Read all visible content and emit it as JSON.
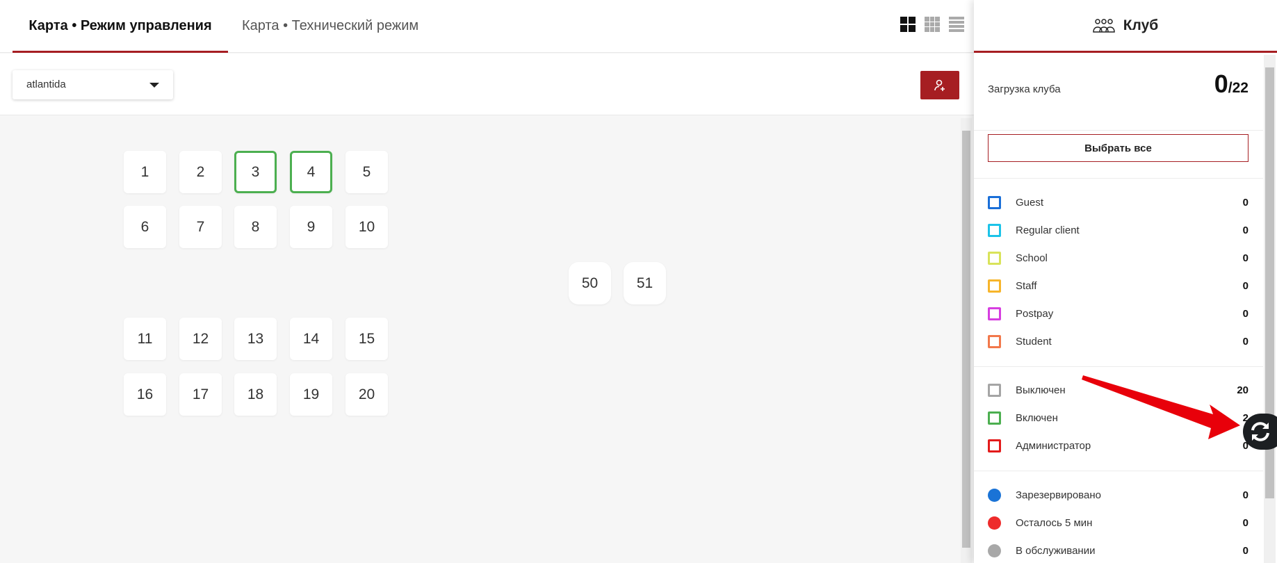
{
  "tabs": [
    {
      "label": "Карта • Режим управления",
      "active": true
    },
    {
      "label": "Карта • Технический режим",
      "active": false
    }
  ],
  "view_icons": [
    "grid-large-icon",
    "grid-small-icon",
    "list-icon"
  ],
  "club_select": {
    "value": "atlantida"
  },
  "map": {
    "cells": [
      {
        "n": "1",
        "state": "off"
      },
      {
        "n": "2",
        "state": "off"
      },
      {
        "n": "3",
        "state": "on"
      },
      {
        "n": "4",
        "state": "on"
      },
      {
        "n": "5",
        "state": "off"
      },
      {
        "n": "6",
        "state": "off"
      },
      {
        "n": "7",
        "state": "off"
      },
      {
        "n": "8",
        "state": "off"
      },
      {
        "n": "9",
        "state": "off"
      },
      {
        "n": "10",
        "state": "off"
      },
      {
        "n": "11",
        "state": "off"
      },
      {
        "n": "12",
        "state": "off"
      },
      {
        "n": "13",
        "state": "off"
      },
      {
        "n": "14",
        "state": "off"
      },
      {
        "n": "15",
        "state": "off"
      },
      {
        "n": "16",
        "state": "off"
      },
      {
        "n": "17",
        "state": "off"
      },
      {
        "n": "18",
        "state": "off"
      },
      {
        "n": "19",
        "state": "off"
      },
      {
        "n": "20",
        "state": "off"
      },
      {
        "n": "50",
        "state": "off"
      },
      {
        "n": "51",
        "state": "off"
      }
    ]
  },
  "panel": {
    "title": "Клуб",
    "load_label": "Загрузка клуба",
    "load_current": "0",
    "load_total": "/22",
    "select_all": "Выбрать все",
    "groups": [
      {
        "label": "Guest",
        "value": "0",
        "color": "#1a6fd8"
      },
      {
        "label": "Regular client",
        "value": "0",
        "color": "#1cc3e8"
      },
      {
        "label": "School",
        "value": "0",
        "color": "#d9e35a"
      },
      {
        "label": "Staff",
        "value": "0",
        "color": "#f7b52b"
      },
      {
        "label": "Postpay",
        "value": "0",
        "color": "#d63ee0"
      },
      {
        "label": "Student",
        "value": "0",
        "color": "#f2784b"
      }
    ],
    "statuses": [
      {
        "label": "Выключен",
        "value": "20",
        "color": "#a5a5a5"
      },
      {
        "label": "Включен",
        "value": "2",
        "color": "#4caf50"
      },
      {
        "label": "Администратор",
        "value": "0",
        "color": "#e31b1b"
      }
    ],
    "states": [
      {
        "label": "Зарезервировано",
        "value": "0",
        "color": "#1a73d6"
      },
      {
        "label": "Осталось 5 мин",
        "value": "0",
        "color": "#ee2b2b"
      },
      {
        "label": "В обслуживании",
        "value": "0",
        "color": "#a8a8a8"
      }
    ]
  }
}
